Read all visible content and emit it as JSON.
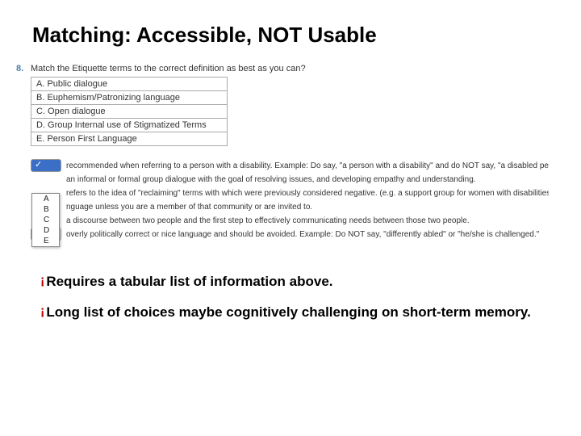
{
  "title": "Matching: Accessible, NOT Usable",
  "question": {
    "number": "8.",
    "prompt": "Match the Etiquette terms to the correct definition as best as you can?",
    "terms": [
      "A. Public dialogue",
      "B. Euphemism/Patronizing language",
      "C. Open dialogue",
      "D. Group Internal use of Stigmatized Terms",
      "E. Person First Language"
    ],
    "dropdown_options": [
      "",
      "A",
      "B",
      "C",
      "D",
      "E"
    ],
    "definitions": [
      "recommended when referring to a person with a disability. Example: Do say, \"a person with a disability\" and do NOT say, \"a disabled person.\"",
      "an informal or formal group dialogue with the goal of resolving issues, and developing empathy and understanding.",
      "refers to the idea of \"reclaiming\" terms with which were previously considered negative. (e.g. a support group for women with disabilities called",
      "nguage unless you are a member of that community or are invited to.",
      "a discourse between two people and the first step to effectively communicating needs between those two people.",
      "overly politically correct or nice language and should be avoided. Example: Do NOT say, \"differently abled\" or \"he/she is challenged.\""
    ]
  },
  "bullets": [
    "Requires a tabular list of information above.",
    "Long list of choices maybe cognitively challenging on short-term memory."
  ]
}
